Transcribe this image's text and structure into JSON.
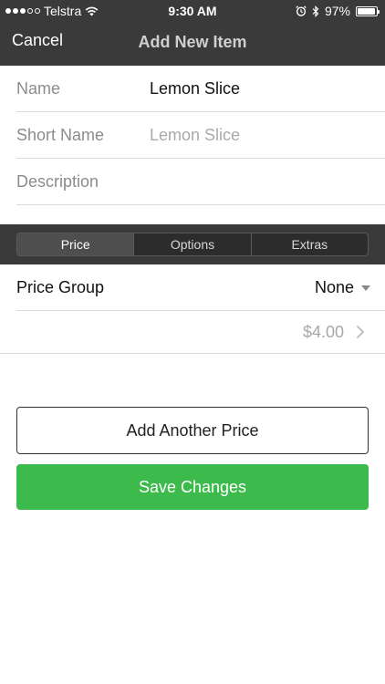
{
  "status_bar": {
    "carrier": "Telstra",
    "time": "9:30 AM",
    "battery": "97%",
    "battery_level": 0.97
  },
  "nav": {
    "cancel_label": "Cancel",
    "title": "Add New Item"
  },
  "form": {
    "name": {
      "label": "Name",
      "value": "Lemon Slice"
    },
    "short_name": {
      "label": "Short Name",
      "placeholder": "Lemon Slice"
    },
    "description": {
      "label": "Description",
      "value": ""
    }
  },
  "tabs": [
    {
      "label": "Price",
      "active": true
    },
    {
      "label": "Options",
      "active": false
    },
    {
      "label": "Extras",
      "active": false
    }
  ],
  "price_group": {
    "label": "Price Group",
    "selected": "None"
  },
  "price_entry": {
    "amount": "$4.00"
  },
  "buttons": {
    "add_price": "Add Another Price",
    "save": "Save Changes"
  },
  "colors": {
    "header": "#3a3a3a",
    "accent_green": "#3cba4c"
  },
  "icons": {
    "wifi": "wifi-icon",
    "alarm": "alarm-icon",
    "bluetooth": "bluetooth-icon",
    "battery": "battery-icon",
    "dropdown": "caret-down-icon",
    "disclosure": "chevron-right-icon"
  }
}
